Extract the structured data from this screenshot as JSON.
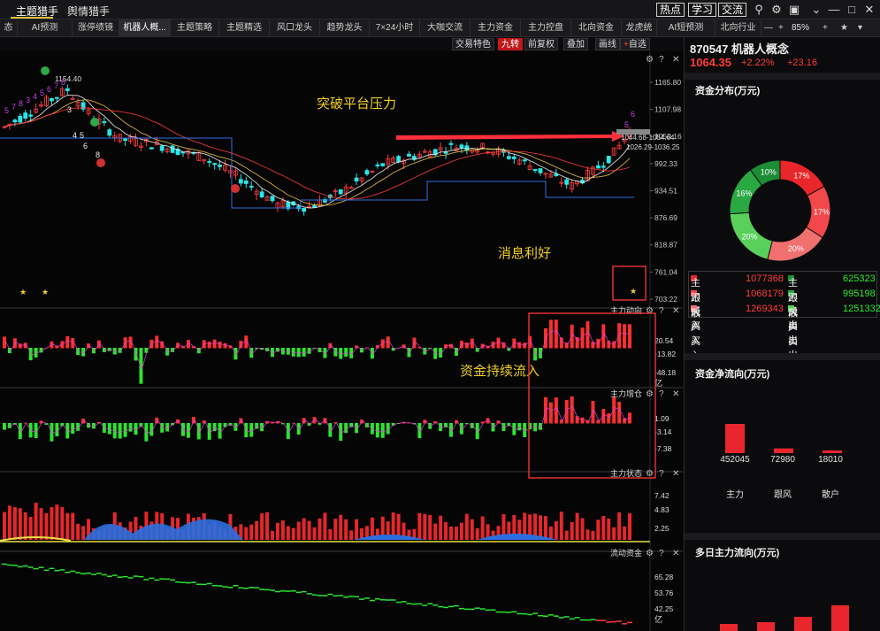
{
  "top_tabs": [
    "主题猎手",
    "舆情猎手"
  ],
  "top_buttons": [
    "热点",
    "学习",
    "交流"
  ],
  "top_icons": [
    "search-icon",
    "gear-icon",
    "window-icon",
    "chevron-down-icon",
    "minimize-icon",
    "maximize-icon",
    "close-icon"
  ],
  "nav_tabs": [
    "态",
    "AI预测",
    "涨停绩镜",
    "机器人概...",
    "主题策略",
    "主题精选",
    "风口龙头",
    "趋势龙头",
    "7×24小时",
    "大咖交流",
    "主力资金",
    "主力控盘",
    "北向资金",
    "龙虎统计",
    "AI短预测",
    "北向行业"
  ],
  "nav_right": {
    "zoom": "85%",
    "icons": [
      "minus-icon",
      "plus-icon",
      "star-icon",
      "caret-down-icon"
    ]
  },
  "toolbar": {
    "items": [
      "交易特色",
      "九转",
      "前复权",
      "叠加",
      "画线",
      "自选"
    ]
  },
  "stock": {
    "title": "870547 机器人概念",
    "price": "1064.35",
    "pct": "+2.22%",
    "chg": "+23.16"
  },
  "price_axis": [
    "1165.80",
    "1107.98",
    "1050.16",
    "992.33",
    "934.51",
    "876.69",
    "818.87",
    "761.04",
    "703.22"
  ],
  "price_annotations": {
    "high": "1154.40",
    "range1": "1044.68-1054.64",
    "range2": "1026.29-1036.25"
  },
  "annotations": {
    "breakout": "突破平台压力",
    "news": "消息利好",
    "inflow": "资金持续流入"
  },
  "panels": {
    "p1": {
      "label": "主力动向",
      "ticks": [
        "20.54",
        "-13.82",
        "-48.18"
      ],
      "unit": "亿"
    },
    "p2": {
      "label": "主力增仓",
      "ticks": [
        "1.09",
        "-3.14",
        "-7.38"
      ]
    },
    "p3": {
      "label": "主力状态",
      "ticks": [
        "7.42",
        "4.83",
        "2.25"
      ]
    },
    "p4": {
      "label": "流动资金",
      "ticks": [
        "65.28",
        "53.76",
        "42.25"
      ],
      "unit": "亿"
    }
  },
  "panel_icons": [
    "gear-icon",
    "help-icon",
    "close-icon"
  ],
  "right_panel": {
    "dist_title": "资金分布(万元)",
    "pie": [
      {
        "label": "17%",
        "value": 17,
        "color": "#e8262b"
      },
      {
        "label": "17%",
        "value": 17,
        "color": "#f2474b"
      },
      {
        "label": "20%",
        "value": 20,
        "color": "#f07070"
      },
      {
        "label": "20%",
        "value": 20,
        "color": "#58d05a"
      },
      {
        "label": "16%",
        "value": 16,
        "color": "#2aa842"
      },
      {
        "label": "10%",
        "value": 10,
        "color": "#1d8c36"
      }
    ],
    "flow_rows": [
      {
        "l_label": "主力买入",
        "l_val": "1077368",
        "r_label": "主力卖出",
        "r_val": "625323"
      },
      {
        "l_label": "跟风买入",
        "l_val": "1068179",
        "r_label": "跟风卖出",
        "r_val": "995198"
      },
      {
        "l_label": "散户买入",
        "l_val": "1269343",
        "r_label": "散户卖出",
        "r_val": "1251332"
      }
    ],
    "net_title": "资金净流向(万元)",
    "net_bars": [
      {
        "label": "主力",
        "value": 452045
      },
      {
        "label": "跟风",
        "value": 72980
      },
      {
        "label": "散户",
        "value": 18010
      }
    ],
    "multi_title": "多日主力流向(万元)"
  },
  "colors": {
    "up": "#ff3b3b",
    "down": "#27e7e7",
    "green": "#2ee82e",
    "accent": "#e8c040"
  }
}
